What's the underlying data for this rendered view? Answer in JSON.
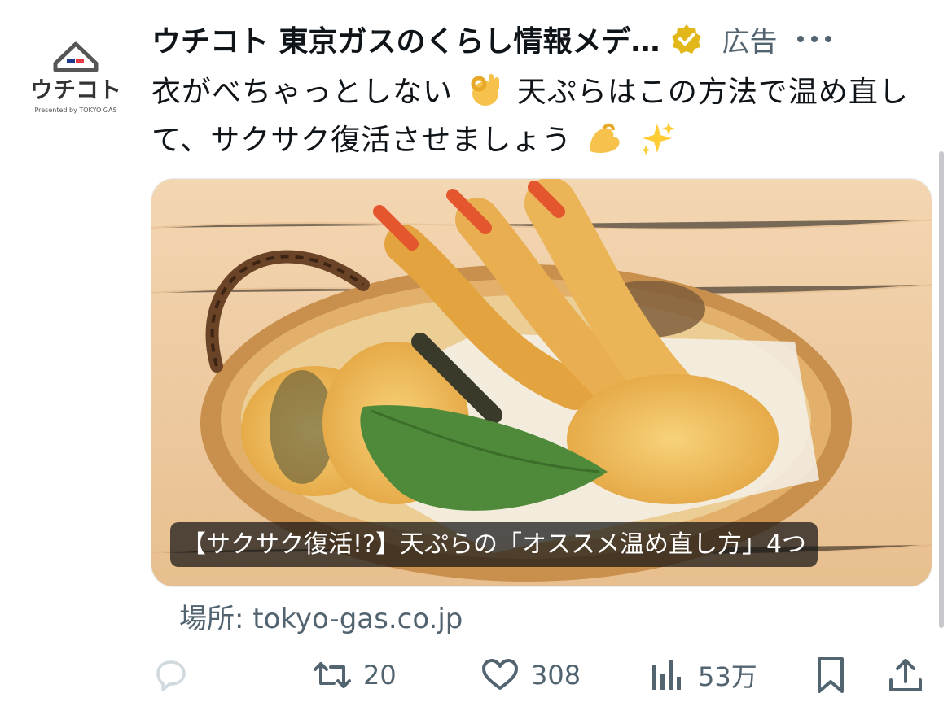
{
  "post": {
    "author": "ウチコト 東京ガスのくらし情報メデ…",
    "ad_label": "広告",
    "text_parts": [
      "衣がべちゃっとしない",
      "天ぷらはこの方法で温め直して、サクサク復活させましょう"
    ],
    "emojis": [
      "ok-hand-emoji",
      "flexed-biceps-emoji",
      "sparkles-emoji"
    ],
    "avatar": {
      "brand": "ウチコト",
      "tagline": "Presented by TOKYO GAS"
    },
    "media": {
      "subject": "tempura-in-bamboo-basket",
      "caption": "【サクサク復活!?】天ぷらの「オススメ温め直し方」4つ"
    },
    "source_label": "場所: tokyo-gas.co.jp"
  },
  "actions": {
    "reply_icon": "reply-icon",
    "retweet_count": "20",
    "like_count": "308",
    "views_count": "53万",
    "bookmark_icon": "bookmark-icon",
    "share_icon": "share-icon"
  },
  "colors": {
    "text": "#0f1419",
    "secondary": "#536471",
    "verified_gold": "#e2b719",
    "logo_red": "#e63946",
    "logo_blue": "#1d3a8a"
  }
}
